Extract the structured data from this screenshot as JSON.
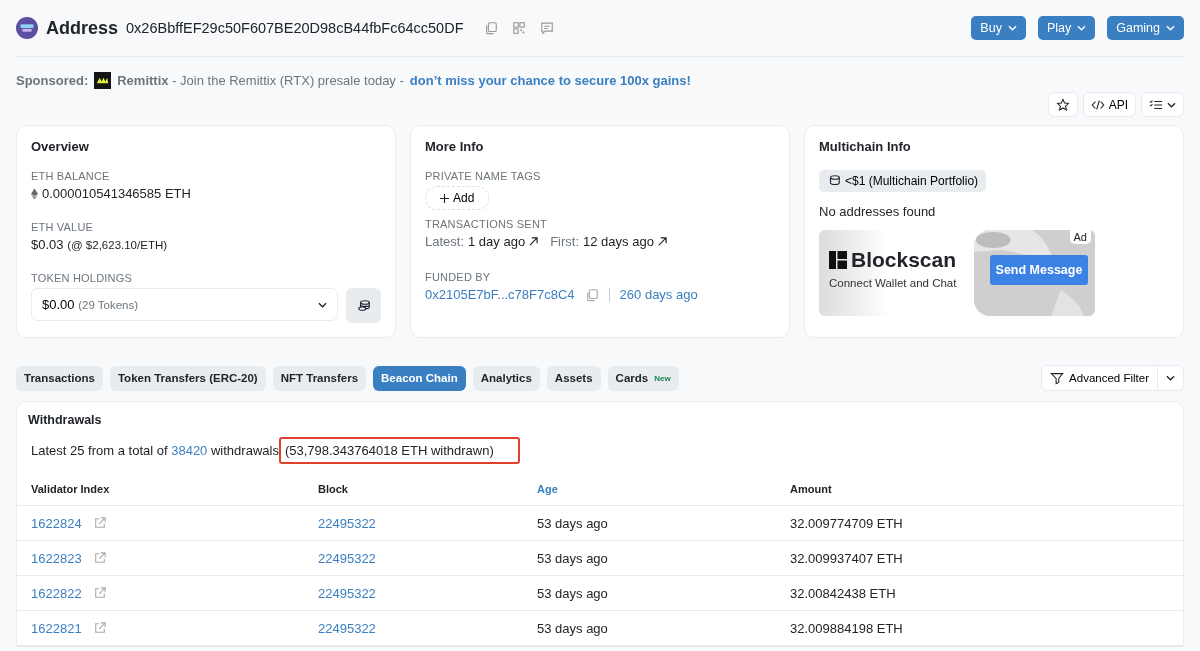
{
  "header": {
    "title": "Address",
    "address": "0x26BbffEF29c50F607BE20D98cB44fbFc64cc50DF",
    "menus": [
      "Buy",
      "Play",
      "Gaming"
    ]
  },
  "sponsored": {
    "label": "Sponsored:",
    "brand": "Remittix",
    "text": " - Join the Remittix (RTX) presale today - ",
    "link": "don’t miss your chance to secure 100x gains!"
  },
  "actions": {
    "api": "API"
  },
  "overview": {
    "title": "Overview",
    "balance_label": "ETH BALANCE",
    "balance": "0.000010541346585 ETH",
    "value_label": "ETH VALUE",
    "value": "$0.03",
    "value_rate": "(@ $2,623.10/ETH)",
    "holdings_label": "TOKEN HOLDINGS",
    "holdings": "$0.00",
    "holdings_count": "(29 Tokens)"
  },
  "more_info": {
    "title": "More Info",
    "tags_label": "PRIVATE NAME TAGS",
    "add": "Add",
    "sent_label": "TRANSACTIONS SENT",
    "latest_label": "Latest:",
    "latest": "1 day ago",
    "first_label": "First:",
    "first": "12 days ago",
    "funded_label": "FUNDED BY",
    "funded_by": "0x2105E7bF...c78F7c8C4",
    "funded_age": "260 days ago"
  },
  "multichain": {
    "title": "Multichain Info",
    "portfolio": "<$1 (Multichain Portfolio)",
    "status": "No addresses found",
    "ad": {
      "brand": "Blockscan",
      "tagline": "Connect Wallet and Chat",
      "cta": "Send Message",
      "badge": "Ad"
    }
  },
  "tabs": [
    {
      "label": "Transactions",
      "selected": false
    },
    {
      "label": "Token Transfers (ERC-20)",
      "selected": false
    },
    {
      "label": "NFT Transfers",
      "selected": false
    },
    {
      "label": "Beacon Chain",
      "selected": true
    },
    {
      "label": "Analytics",
      "selected": false
    },
    {
      "label": "Assets",
      "selected": false
    },
    {
      "label": "Cards",
      "selected": false,
      "badge": "New"
    }
  ],
  "filter": {
    "label": "Advanced Filter"
  },
  "withdrawals": {
    "title": "Withdrawals",
    "summary_prefix": "Latest 25 from a total of ",
    "total": "38420",
    "summary_mid": " withdrawals",
    "summary_note": "(53,798.343764018 ETH withdrawn)",
    "note_highlighted": true,
    "columns": [
      {
        "label": "Validator Index",
        "link": false
      },
      {
        "label": "Block",
        "link": false
      },
      {
        "label": "Age",
        "link": true
      },
      {
        "label": "Amount",
        "link": false
      }
    ],
    "rows": [
      {
        "validator": "1622824",
        "block": "22495322",
        "age": "53 days ago",
        "amount": "32.009774709 ETH"
      },
      {
        "validator": "1622823",
        "block": "22495322",
        "age": "53 days ago",
        "amount": "32.009937407 ETH"
      },
      {
        "validator": "1622822",
        "block": "22495322",
        "age": "53 days ago",
        "amount": "32.00842438 ETH"
      },
      {
        "validator": "1622821",
        "block": "22495322",
        "age": "53 days ago",
        "amount": "32.009884198 ETH"
      }
    ]
  }
}
